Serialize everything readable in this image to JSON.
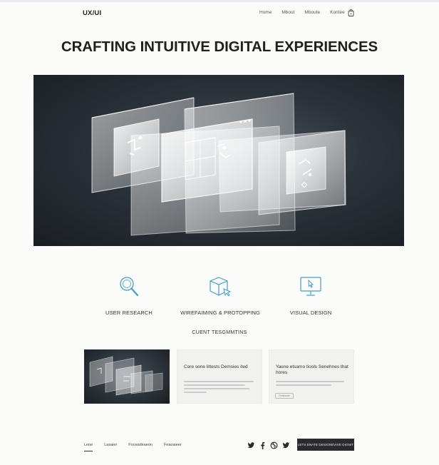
{
  "header": {
    "logo": "UX/UI",
    "nav": [
      "Home",
      "Mbout",
      "Mboute",
      "Kontee"
    ],
    "cart_icon": "shopping-bag-icon"
  },
  "hero": {
    "title": "CRAFTING INTUITIVE DIGITAL EXPERIENCES",
    "image": "layered-glass-ui-panels"
  },
  "services": [
    {
      "label": "USER RESEARCH",
      "icon": "magnifier-icon"
    },
    {
      "label": "WIREFAIMING & PROTOPPING",
      "icon": "cube-cursor-icon"
    },
    {
      "label": "VISUAL DESIGN",
      "icon": "monitor-cursor-icon"
    }
  ],
  "testimonials": {
    "title": "CUENT TESGMMTINS",
    "cards": [
      {
        "heading": "Core sone littests Demsies ited"
      },
      {
        "heading": "Yasne etsamo tiools Senehnes that hores",
        "button": "Rntlesalle"
      }
    ]
  },
  "footer": {
    "nav": [
      "Lene",
      "Lasaier",
      "Foceadeaeon",
      "Feaoaieer"
    ],
    "social_icons": [
      "twitter-icon",
      "facebook-icon",
      "dribbble-icon",
      "twitter-icon"
    ],
    "cta": "LETS ENATE DESIGNEVIVE DIGNIT"
  },
  "colors": {
    "accent_icon": "#3ea0c8",
    "dark": "#2a2b2c",
    "background": "#fbfbfa"
  }
}
